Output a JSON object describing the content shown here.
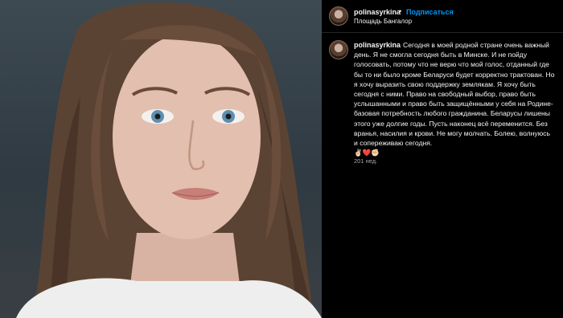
{
  "post": {
    "username": "polinasyrkina",
    "separator": "•",
    "follow_label": "Подписаться",
    "location": "Площадь Бангалор",
    "caption": "Сегодня в моей родной стране очень важный день. Я не смогла сегодня быть в Минске. И не пойду голосовать, потому что не верю что мой голос, отданный где бы то ни было кроме Беларуси будет корректно трактован. Но я хочу выразить свою поддержку землякам. Я хочу быть сегодня с ними. Право на свободный выбор, право быть услышанными и право быть защищёнными у себя на Родине- базовая потребность любого гражданина. Беларусы лишены этого уже долгие годы. Пусть наконец всё переменится. Без вранья, насилия и крови. Не могу молчать. Болею, волнуюсь и сопереживаю сегодня.\n✌🏻❤️✊🏻",
    "timestamp": "201 нед."
  },
  "colors": {
    "follow_blue": "#0095f6",
    "background": "#000000",
    "text": "#f5f5f5",
    "muted": "#a8a8a8"
  },
  "icons": {
    "avatar": "profile-avatar"
  }
}
